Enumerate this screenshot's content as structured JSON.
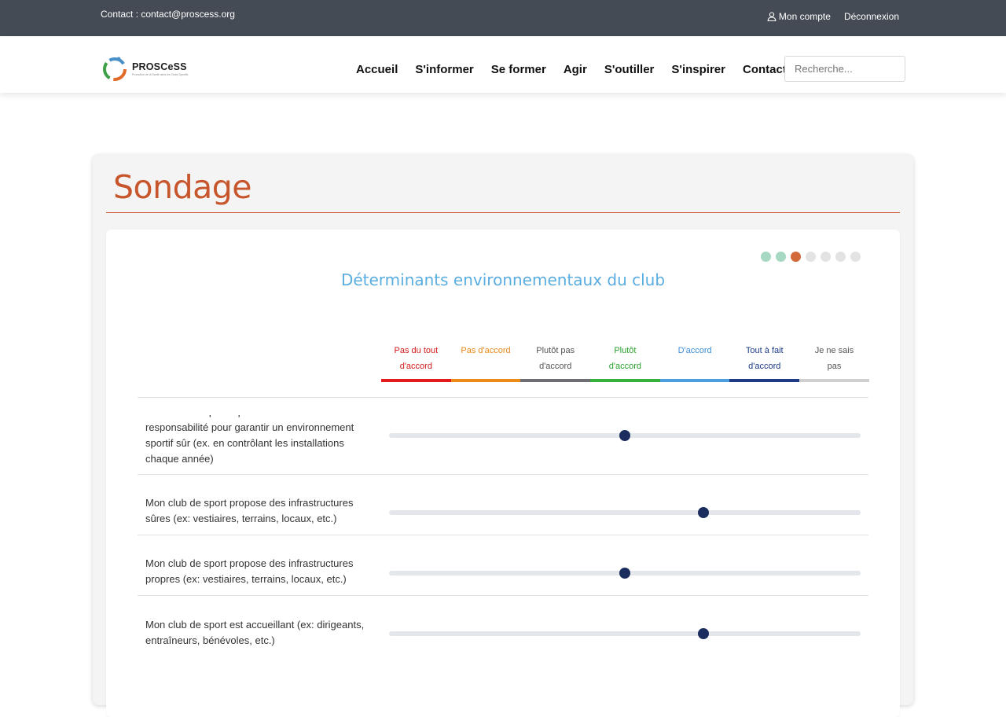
{
  "topbar": {
    "contact": "Contact  : contact@proscess.org",
    "account": "Mon compte",
    "logout": "Déconnexion"
  },
  "brand": {
    "name": "PROSCeSS",
    "tagline": "Promotion de la Santé dans les Clubs Sportifs"
  },
  "nav": [
    "Accueil",
    "S'informer",
    "Se former",
    "Agir",
    "S'outiller",
    "S'inspirer",
    "Contact"
  ],
  "search": {
    "placeholder": "Recherche..."
  },
  "page": {
    "title": "Sondage",
    "section_title": "Déterminants environnementaux du club"
  },
  "progress": {
    "current": 3,
    "total": 7,
    "colors": [
      "#a5d9c2",
      "#a5d9c2",
      "#d2693b",
      "#e3e3e3",
      "#e3e3e3",
      "#e3e3e3",
      "#e3e3e3"
    ]
  },
  "scale": [
    {
      "l1": "Pas du tout",
      "l2": "d'accord",
      "color": "#e31a1a",
      "text": "#d41a1a"
    },
    {
      "l1": "Pas d'accord",
      "l2": "",
      "color": "#ec8c17",
      "text": "#e8891a"
    },
    {
      "l1": "Plutôt pas",
      "l2": "d'accord",
      "color": "#6d6f72",
      "text": "#555555"
    },
    {
      "l1": "Plutôt",
      "l2": "d'accord",
      "color": "#35b13a",
      "text": "#2aa12e"
    },
    {
      "l1": "D'accord",
      "l2": "",
      "color": "#4b9ee0",
      "text": "#3d8dd6"
    },
    {
      "l1": "Tout à fait",
      "l2": "d'accord",
      "color": "#1c3a85",
      "text": "#1b3a86"
    },
    {
      "l1": "Je ne sais",
      "l2": "pas",
      "color": "#cfcfcf",
      "text": "#555555"
    }
  ],
  "questions": [
    {
      "text": "Mon club de sport a pris des mesures de responsabilité pour garantir un environnement sportif sûr (ex. en contrôlant les installations chaque année)",
      "value": 0.5
    },
    {
      "text": "Mon club de sport propose des infrastructures sûres (ex: vestiaires, terrains, locaux, etc.)",
      "value": 0.667
    },
    {
      "text": "Mon club de sport propose des infrastructures propres (ex: vestiaires, terrains, locaux, etc.)",
      "value": 0.5
    },
    {
      "text": "Mon club de sport est accueillant (ex: dirigeants, entraîneurs, bénévoles, etc.)",
      "value": 0.667
    }
  ]
}
